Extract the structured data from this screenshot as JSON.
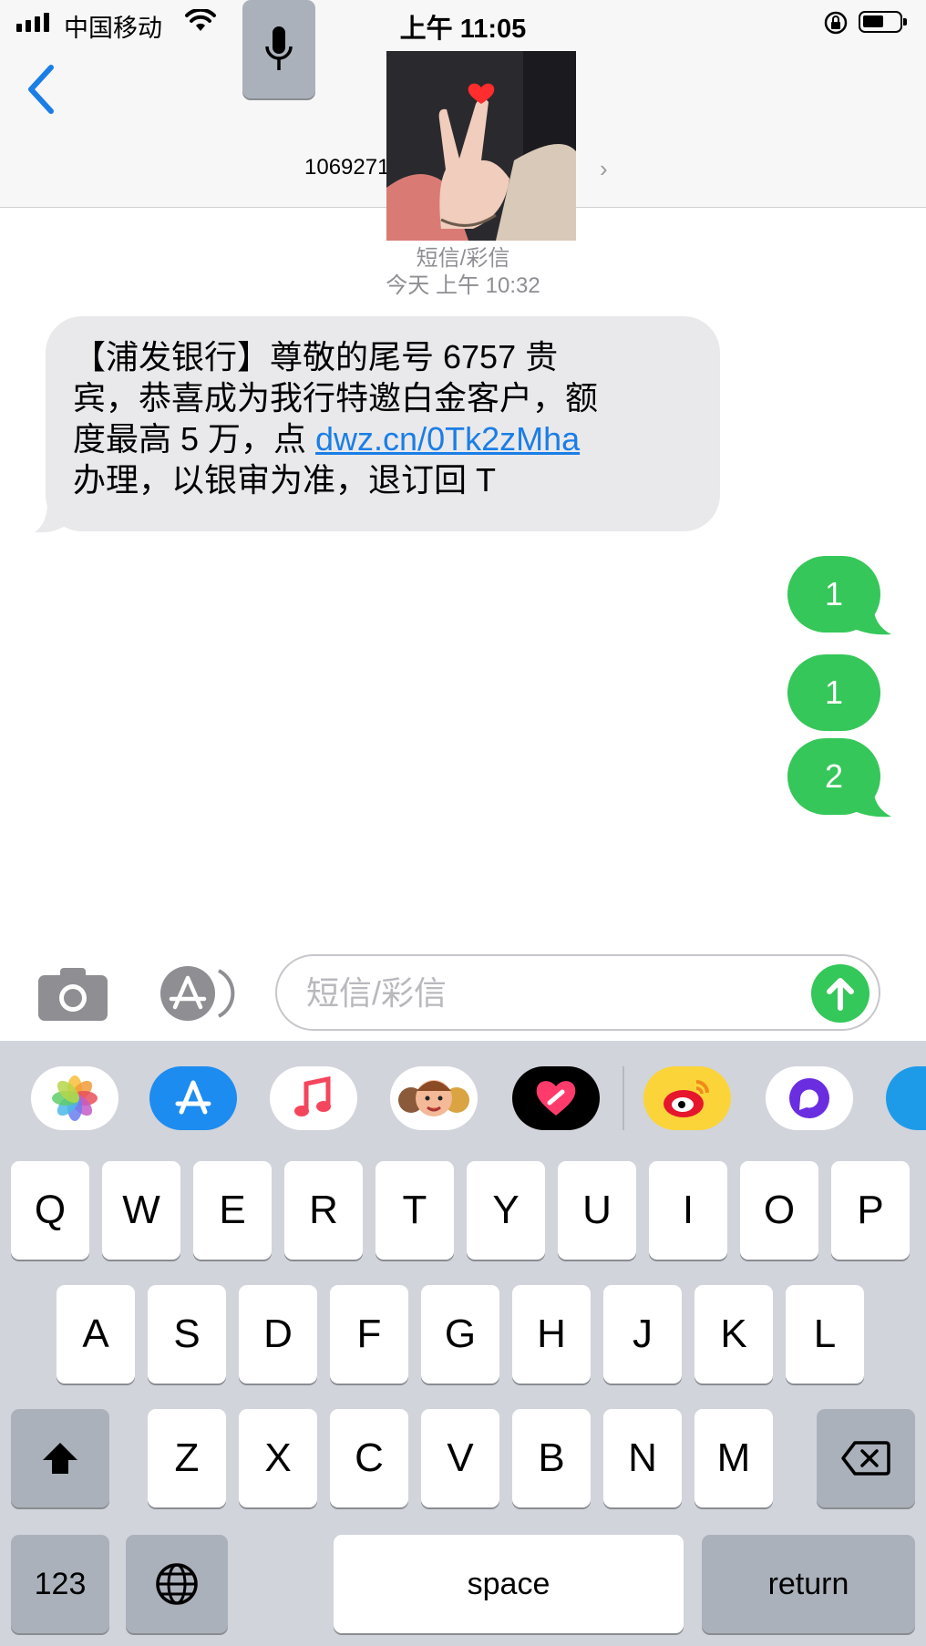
{
  "status_bar": {
    "carrier": "中国移动",
    "time": "上午 11:05"
  },
  "header": {
    "contact_number": "10692710",
    "chevron": "›",
    "back_icon": "chevron-left-icon",
    "avatar": "photo of a hand making a peace sign with a red heart"
  },
  "thread": {
    "message_type": "短信/彩信",
    "timestamp": "今天 上午 10:32",
    "incoming": {
      "lines": [
        "【浦发银行】尊敬的尾号 6757 贵",
        "宾，恭喜成为我行特邀白金客户，额",
        "度最高 5 万，点 "
      ],
      "link": "dwz.cn/0Tk2zMha",
      "last_line": "办理，以银审为准，退订回 T"
    },
    "outgoing": [
      "1",
      "1",
      "2"
    ]
  },
  "composer": {
    "placeholder": "短信/彩信",
    "camera_icon": "camera-icon",
    "apps_icon": "app-store-icon",
    "send_icon": "arrow-up-icon"
  },
  "app_drawer": [
    {
      "name": "photos-icon"
    },
    {
      "name": "app-store-icon"
    },
    {
      "name": "music-icon"
    },
    {
      "name": "memoji-icon"
    },
    {
      "name": "heart-app-icon"
    },
    {
      "name": "weibo-icon"
    },
    {
      "name": "chat-bubble-icon"
    },
    {
      "name": "partial-app-icon"
    }
  ],
  "keyboard": {
    "row1": [
      "Q",
      "W",
      "E",
      "R",
      "T",
      "Y",
      "U",
      "I",
      "O",
      "P"
    ],
    "row2": [
      "A",
      "S",
      "D",
      "F",
      "G",
      "H",
      "J",
      "K",
      "L"
    ],
    "row3": [
      "Z",
      "X",
      "C",
      "V",
      "B",
      "N",
      "M"
    ],
    "numbers_key": "123",
    "space_key": "space",
    "return_key": "return",
    "shift_icon": "shift-icon",
    "delete_icon": "delete-icon",
    "globe_icon": "globe-icon",
    "mic_icon": "microphone-icon"
  },
  "colors": {
    "accent_blue": "#1a7ee6",
    "bubble_green": "#35c759",
    "bubble_gray": "#e9e9eb",
    "keyboard_bg": "#d1d4db"
  }
}
